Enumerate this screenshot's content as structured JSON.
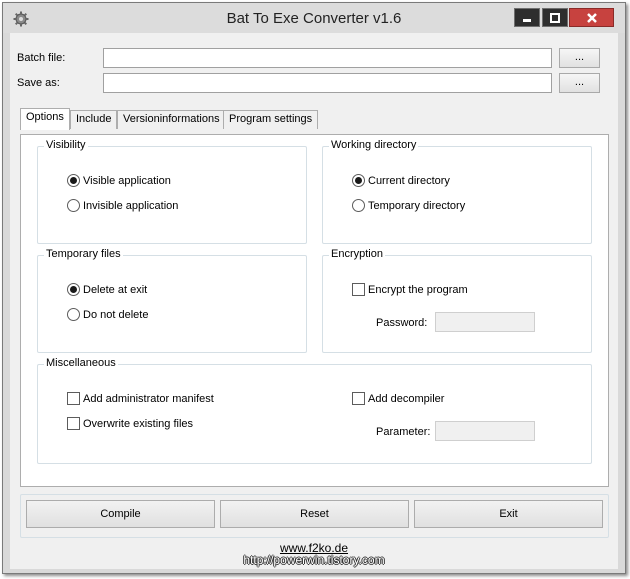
{
  "window": {
    "title": "Bat To Exe Converter v1.6",
    "icon": "gear-icon",
    "controls": [
      "minimize-icon",
      "maximize-icon",
      "close-icon"
    ],
    "accent_close": "#c7423f"
  },
  "files": {
    "batch_label": "Batch file:",
    "batch_value": "",
    "save_label": "Save as:",
    "save_value": "",
    "browse_label": "..."
  },
  "tabs": [
    {
      "label": "Options",
      "active": true
    },
    {
      "label": "Include",
      "active": false
    },
    {
      "label": "Versioninformations",
      "active": false
    },
    {
      "label": "Program settings",
      "active": false
    }
  ],
  "visibility": {
    "title": "Visibility",
    "options": [
      {
        "label": "Visible application",
        "checked": true
      },
      {
        "label": "Invisible application",
        "checked": false
      }
    ]
  },
  "working_directory": {
    "title": "Working directory",
    "options": [
      {
        "label": "Current directory",
        "checked": true
      },
      {
        "label": "Temporary directory",
        "checked": false
      }
    ]
  },
  "temporary_files": {
    "title": "Temporary files",
    "options": [
      {
        "label": "Delete at exit",
        "checked": true
      },
      {
        "label": "Do not delete",
        "checked": false
      }
    ]
  },
  "encryption": {
    "title": "Encryption",
    "encrypt_label": "Encrypt the program",
    "encrypt_checked": false,
    "password_label": "Password:",
    "password_value": ""
  },
  "miscellaneous": {
    "title": "Miscellaneous",
    "admin_manifest_label": "Add administrator manifest",
    "overwrite_label": "Overwrite existing files",
    "decompiler_label": "Add decompiler",
    "parameter_label": "Parameter:",
    "parameter_value": ""
  },
  "actions": {
    "compile": "Compile",
    "reset": "Reset",
    "exit": "Exit"
  },
  "footer": {
    "link": "www.f2ko.de",
    "watermark": "http://powerwin.tistory.com"
  }
}
